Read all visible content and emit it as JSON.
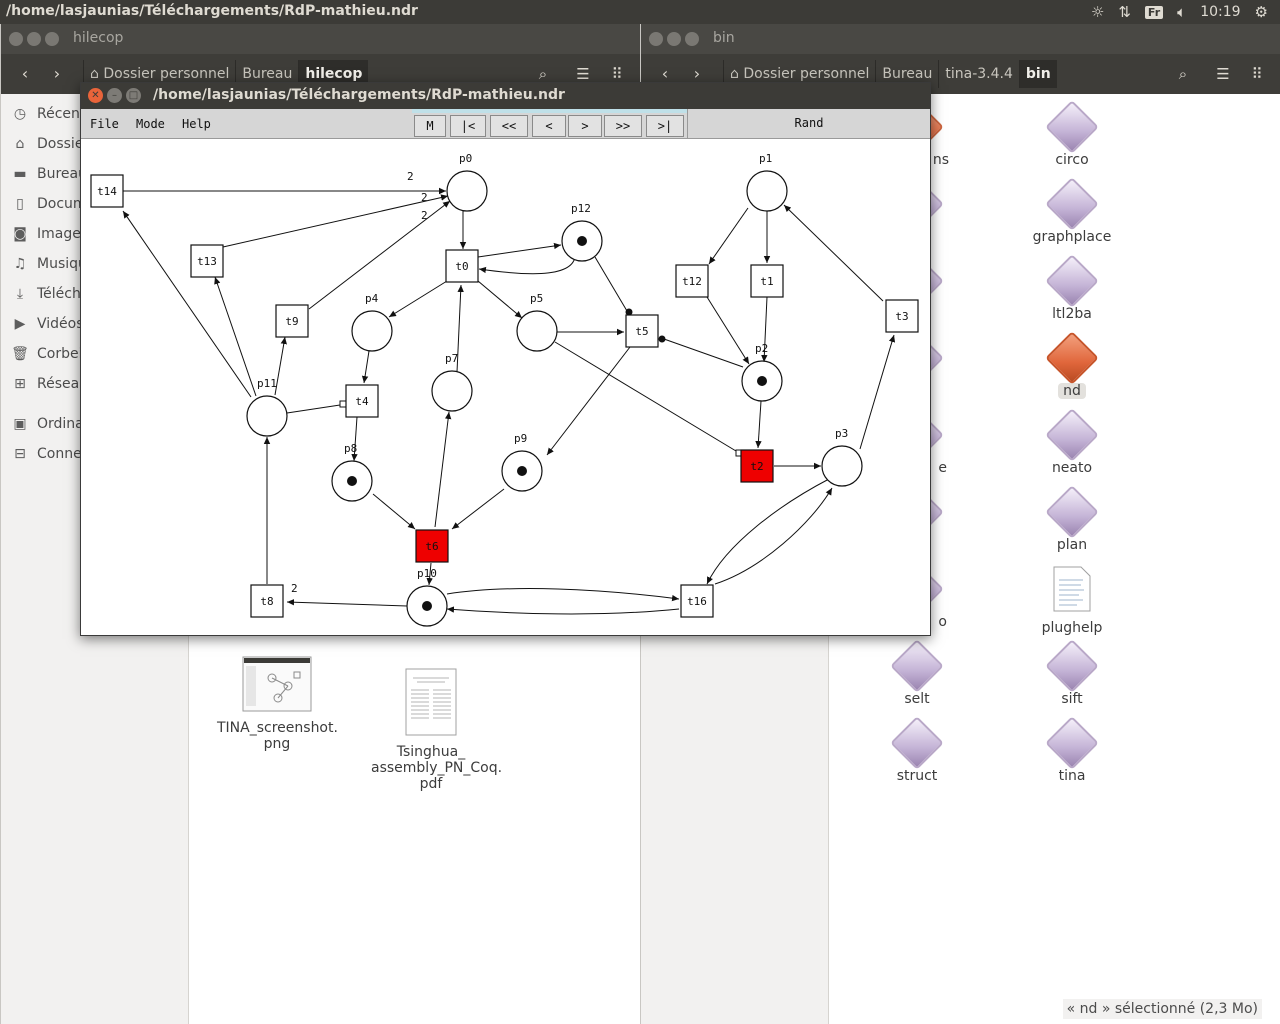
{
  "topbar": {
    "title": "/home/lasjaunias/Téléchargements/RdP-mathieu.ndr",
    "keyboard": "Fr",
    "clock": "10:19"
  },
  "left_window": {
    "title": "hilecop",
    "crumbs": [
      "Dossier personnel",
      "Bureau",
      "hilecop"
    ],
    "sidebar": [
      "Récents",
      "Dossier personnel",
      "Bureau",
      "Documents",
      "Images",
      "Musique",
      "Téléchargements",
      "Vidéos",
      "Corbeille",
      "Réseau",
      "Ordinateur",
      "Connexion à un serveur"
    ],
    "sidebar_icons": [
      "clock-icon",
      "home-icon",
      "folder-icon",
      "document-icon",
      "camera-icon",
      "music-icon",
      "download-icon",
      "video-icon",
      "trash-icon",
      "network-icon",
      "computer-icon",
      "server-icon"
    ],
    "files": [
      {
        "name_line1": "TINA_screenshot.",
        "name_line2": "png"
      },
      {
        "name_line1": "Tsinghua_",
        "name_line2": "assembly_PN_Coq.",
        "name_line3": "pdf"
      }
    ]
  },
  "right_window": {
    "title": "bin",
    "crumbs": [
      "Dossier personnel",
      "Bureau",
      "tina-3.4.4",
      "bin"
    ],
    "left_column_partial": [
      "ns",
      "",
      "",
      "",
      "e",
      "",
      "o",
      "",
      ""
    ],
    "files_right": [
      "circo",
      "graphplace",
      "ltl2ba",
      "nd",
      "neato",
      "plan",
      "plughelp",
      "sift",
      "tina"
    ],
    "files_left": [
      "selt",
      "struct"
    ],
    "selected": "nd",
    "status": "« nd » sélectionné  (2,3 Mo)"
  },
  "nd_window": {
    "title": "/home/lasjaunias/Téléchargements/RdP-mathieu.ndr",
    "menu": [
      "File",
      "Mode",
      "Help"
    ],
    "controls": [
      "M",
      "|<",
      "<<",
      "<",
      ">",
      ">>",
      ">|"
    ],
    "rand": "Rand",
    "colors": {
      "fired": "#ee0000",
      "ink": "#111111"
    },
    "net": {
      "places": [
        {
          "id": "p0",
          "marked": false
        },
        {
          "id": "p1",
          "marked": false
        },
        {
          "id": "p2",
          "marked": true
        },
        {
          "id": "p3",
          "marked": false
        },
        {
          "id": "p4",
          "marked": false
        },
        {
          "id": "p5",
          "marked": false
        },
        {
          "id": "p7",
          "marked": false
        },
        {
          "id": "p8",
          "marked": true
        },
        {
          "id": "p9",
          "marked": true
        },
        {
          "id": "p10",
          "marked": true
        },
        {
          "id": "p11",
          "marked": false
        },
        {
          "id": "p12",
          "marked": true
        }
      ],
      "transitions": [
        {
          "id": "t0",
          "enabled": false
        },
        {
          "id": "t1",
          "enabled": false
        },
        {
          "id": "t2",
          "enabled": true
        },
        {
          "id": "t3",
          "enabled": false
        },
        {
          "id": "t4",
          "enabled": false
        },
        {
          "id": "t5",
          "enabled": false
        },
        {
          "id": "t6",
          "enabled": true
        },
        {
          "id": "t8",
          "enabled": false
        },
        {
          "id": "t9",
          "enabled": false
        },
        {
          "id": "t12",
          "enabled": false
        },
        {
          "id": "t13",
          "enabled": false
        },
        {
          "id": "t14",
          "enabled": false
        },
        {
          "id": "t16",
          "enabled": false
        }
      ],
      "weights": [
        "2",
        "2",
        "2",
        "2"
      ]
    }
  }
}
